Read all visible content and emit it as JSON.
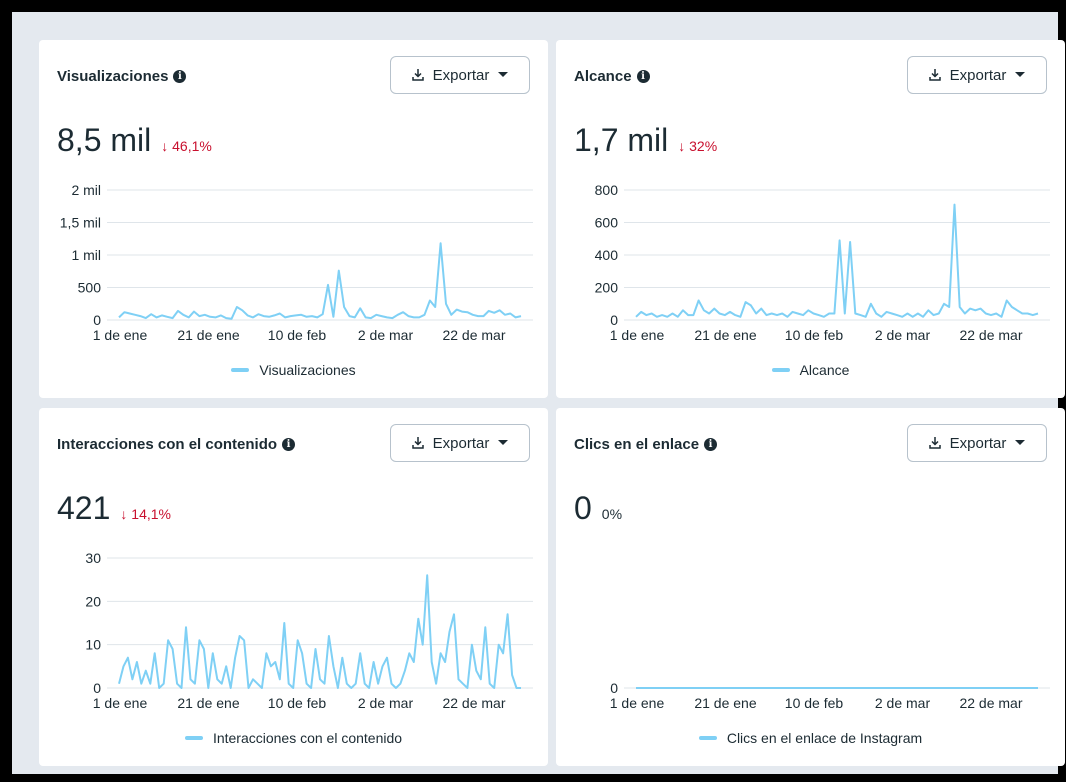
{
  "colors": {
    "line": "#7fd0f5",
    "decrease": "#c8102e",
    "grid": "#dfe5ea"
  },
  "export_label": "Exportar",
  "x_ticks": [
    "1 de ene",
    "21 de ene",
    "10 de feb",
    "2 de mar",
    "22 de mar"
  ],
  "cards": [
    {
      "title": "Visualizaciones",
      "value": "8,5 mil",
      "change": "46,1%",
      "legend": "Visualizaciones",
      "chart_data": {
        "type": "line",
        "x_ticks": [
          "1 de ene",
          "21 de ene",
          "10 de feb",
          "2 de mar",
          "22 de mar"
        ],
        "y_ticks": [
          "0",
          "500",
          "1 mil",
          "1,5 mil",
          "2 mil"
        ],
        "ylim": [
          0,
          2000
        ],
        "series": [
          {
            "name": "Visualizaciones",
            "values": [
              40,
              120,
              100,
              80,
              60,
              30,
              90,
              40,
              70,
              50,
              30,
              140,
              80,
              40,
              130,
              60,
              80,
              50,
              40,
              70,
              30,
              20,
              200,
              150,
              70,
              40,
              90,
              60,
              50,
              70,
              100,
              40,
              60,
              70,
              80,
              50,
              60,
              40,
              90,
              540,
              50,
              760,
              200,
              60,
              40,
              180,
              40,
              30,
              80,
              60,
              40,
              30,
              80,
              120,
              60,
              40,
              40,
              80,
              300,
              200,
              1180,
              250,
              80,
              160,
              130,
              120,
              80,
              60,
              60,
              140,
              110,
              150,
              80,
              100,
              40,
              60
            ]
          }
        ]
      }
    },
    {
      "title": "Alcance",
      "value": "1,7 mil",
      "change": "32%",
      "legend": "Alcance",
      "chart_data": {
        "type": "line",
        "x_ticks": [
          "1 de ene",
          "21 de ene",
          "10 de feb",
          "2 de mar",
          "22 de mar"
        ],
        "y_ticks": [
          "0",
          "200",
          "400",
          "600",
          "800"
        ],
        "ylim": [
          0,
          800
        ],
        "series": [
          {
            "name": "Alcance",
            "values": [
              20,
              50,
              30,
              40,
              20,
              30,
              20,
              40,
              20,
              60,
              30,
              30,
              120,
              60,
              40,
              70,
              40,
              30,
              50,
              30,
              20,
              110,
              90,
              40,
              70,
              30,
              40,
              30,
              40,
              20,
              50,
              40,
              30,
              60,
              40,
              30,
              20,
              40,
              40,
              490,
              40,
              480,
              40,
              30,
              20,
              100,
              40,
              20,
              50,
              40,
              30,
              20,
              40,
              20,
              40,
              20,
              60,
              30,
              40,
              100,
              80,
              710,
              80,
              40,
              70,
              60,
              70,
              40,
              30,
              40,
              20,
              120,
              80,
              60,
              40,
              40,
              30,
              40
            ]
          }
        ]
      }
    },
    {
      "title": "Interacciones con el contenido",
      "value": "421",
      "change": "14,1%",
      "legend": "Interacciones con el contenido",
      "chart_data": {
        "type": "line",
        "x_ticks": [
          "1 de ene",
          "21 de ene",
          "10 de feb",
          "2 de mar",
          "22 de mar"
        ],
        "y_ticks": [
          "0",
          "10",
          "20",
          "30"
        ],
        "ylim": [
          0,
          30
        ],
        "series": [
          {
            "name": "Interacciones con el contenido",
            "values": [
              1,
              5,
              7,
              2,
              6,
              1,
              4,
              1,
              8,
              0,
              1,
              11,
              9,
              1,
              0,
              14,
              2,
              1,
              11,
              9,
              0,
              8,
              2,
              1,
              5,
              0,
              7,
              12,
              11,
              0,
              2,
              1,
              0,
              8,
              5,
              6,
              2,
              15,
              1,
              0,
              11,
              8,
              1,
              0,
              9,
              2,
              1,
              12,
              5,
              0,
              7,
              1,
              0,
              1,
              8,
              1,
              0,
              6,
              1,
              5,
              7,
              1,
              0,
              1,
              4,
              8,
              6,
              16,
              10,
              26,
              6,
              1,
              8,
              6,
              13,
              17,
              2,
              1,
              0,
              10,
              4,
              2,
              14,
              1,
              0,
              10,
              8,
              17,
              3,
              0,
              0
            ]
          }
        ]
      }
    },
    {
      "title": "Clics en el enlace",
      "value": "0",
      "change": "0%",
      "legend": "Clics en el enlace de Instagram",
      "chart_data": {
        "type": "line",
        "x_ticks": [
          "1 de ene",
          "21 de ene",
          "10 de feb",
          "2 de mar",
          "22 de mar"
        ],
        "y_ticks": [
          "0"
        ],
        "ylim": [
          0,
          1
        ],
        "series": [
          {
            "name": "Clics en el enlace de Instagram",
            "values": [
              0,
              0,
              0,
              0,
              0,
              0,
              0,
              0,
              0,
              0,
              0,
              0,
              0,
              0,
              0,
              0,
              0,
              0,
              0,
              0,
              0,
              0,
              0,
              0,
              0,
              0,
              0,
              0,
              0,
              0,
              0,
              0,
              0,
              0,
              0,
              0,
              0,
              0,
              0,
              0,
              0,
              0,
              0,
              0,
              0,
              0,
              0,
              0,
              0,
              0,
              0,
              0,
              0,
              0,
              0,
              0,
              0,
              0,
              0,
              0,
              0,
              0,
              0,
              0,
              0,
              0,
              0,
              0,
              0,
              0,
              0,
              0,
              0,
              0,
              0,
              0,
              0,
              0,
              0,
              0
            ]
          }
        ]
      }
    }
  ]
}
